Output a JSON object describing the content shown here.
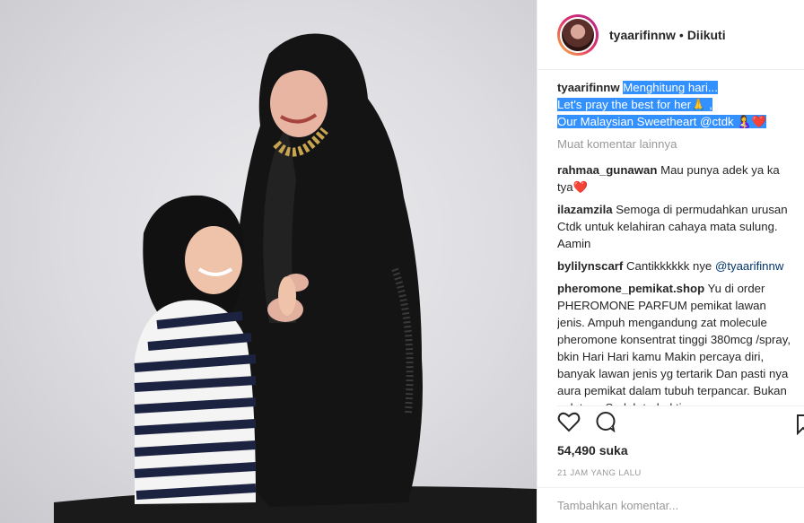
{
  "post": {
    "username": "tyaarifinnw",
    "separator": "•",
    "follow_status": "Diikuti",
    "caption_user": "tyaarifinnw",
    "caption_lines": [
      "Menghitung hari...",
      "Let's pray the best for her🙏 ,",
      "Our Malaysian Sweetheart @ctdk 🤱❤️"
    ],
    "load_more": "Muat komentar lainnya",
    "comments": [
      {
        "user": "rahmaa_gunawan",
        "text": "Mau punya adek ya ka tya❤️"
      },
      {
        "user": "ilazamzila",
        "text": "Semoga di permudahkan urusan Ctdk untuk kelahiran cahaya mata sulung. Aamin"
      },
      {
        "user": "bylilynscarf",
        "text": "Cantikkkkkk nye",
        "mention": "@tyaarifinnw"
      },
      {
        "user": "pheromone_pemikat.shop",
        "text": "Yu di order PHEROMONE PARFUM pemikat lawan jenis. Ampuh mengandung zat molecule pheromone konsentrat tinggi 380mcg /spray, bkin Hari Hari kamu Makin percaya diri, banyak lawan jenis yg tertarik Dan pasti nya aura pemikat dalam tubuh terpancar. Bukan pelet ya. Sudah terbukti"
      }
    ],
    "likes": "54,490 suka",
    "time": "21 JAM YANG LALU",
    "comment_placeholder": "Tambahkan komentar...",
    "icons": [
      "heart-icon",
      "comment-icon",
      "bookmark-icon"
    ]
  }
}
